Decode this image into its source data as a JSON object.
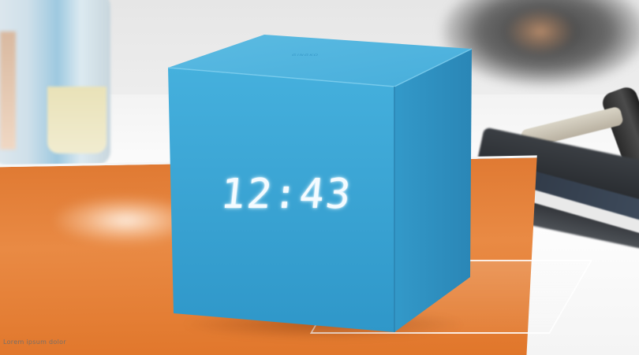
{
  "scene": {
    "description_free": true,
    "colors": {
      "cube_front": "#3aa6d6",
      "cube_top": "#4fb5df",
      "cube_side": "#2c8fbf",
      "book_orange": "#e3792f",
      "display_glow": "#f4fbff"
    },
    "clock": {
      "time": "12:43"
    },
    "brand": {
      "text": "GINGKO"
    },
    "book": {
      "caption": "Lorem ipsum dolor"
    },
    "icons": [
      "clock-cube",
      "bottle",
      "orange-book",
      "wallet",
      "car-key"
    ]
  }
}
